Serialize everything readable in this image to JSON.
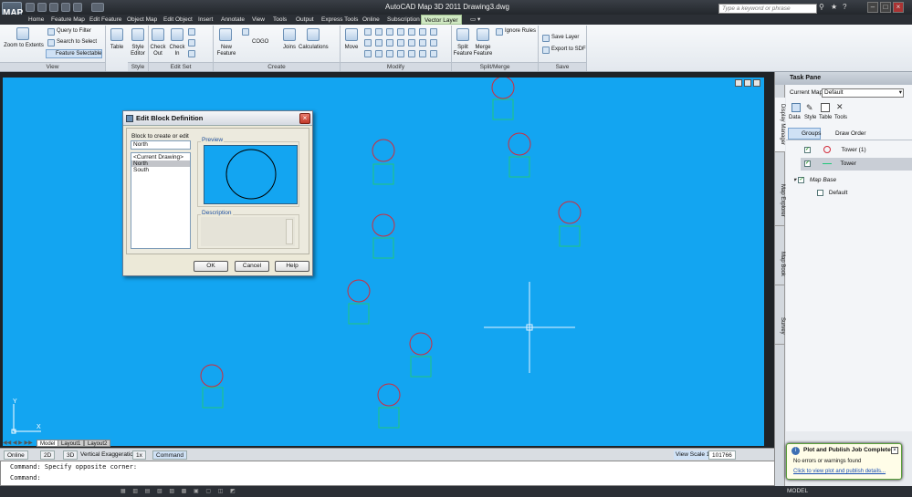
{
  "window": {
    "title": "AutoCAD Map 3D 2011    Drawing3.dwg",
    "app_button": "MAP",
    "search_placeholder": "Type a keyword or phrase"
  },
  "menu_tabs": [
    "Home",
    "Feature Map",
    "Edit Feature",
    "Object Map",
    "Edit Object",
    "Insert",
    "Annotate",
    "View",
    "Tools",
    "Output",
    "Express Tools",
    "Online",
    "Subscription",
    "Vector Layer"
  ],
  "active_tab": "Vector Layer",
  "ribbon": {
    "view": {
      "label": "View",
      "zoom": "Zoom to Extents",
      "query": "Query to Filter",
      "search": "Search to Select",
      "feature_selectable": "Feature Selectable"
    },
    "table": {
      "label": "Table"
    },
    "style": {
      "label": "Style",
      "style_editor": "Style Editor"
    },
    "editset": {
      "label": "Edit Set",
      "check_out": "Check Out",
      "check_in": "Check In"
    },
    "create": {
      "label": "Create",
      "new_feature": "New Feature",
      "cogo": "COGO",
      "joins": "Joins",
      "calculations": "Calculations"
    },
    "modify": {
      "label": "Modify",
      "move": "Move"
    },
    "splitmerge": {
      "label": "Split/Merge",
      "split": "Split Feature",
      "merge": "Merge Feature",
      "ignore": "Ignore Rules"
    },
    "save": {
      "label": "Save",
      "save_layer": "Save Layer",
      "export": "Export to SDF"
    }
  },
  "layout_tabs": [
    "Model",
    "Layout1",
    "Layout2"
  ],
  "status_bar": {
    "online": "Online",
    "view_2d": "2D",
    "view_3d": "3D",
    "vertical_exaggeration_label": "Vertical Exaggeration:",
    "vertical_exaggeration_value": "1x",
    "command": "Command",
    "view_scale_label": "View Scale",
    "view_scale_prefix": "1 :",
    "view_scale_value": "101766"
  },
  "command_lines": [
    "Command: Specify opposite corner:",
    "Command:"
  ],
  "app_status": {
    "model": "MODEL"
  },
  "task_pane": {
    "title": "Task Pane",
    "vertical_tabs": [
      "Display Manager",
      "Map Explorer",
      "Map Book",
      "Survey"
    ],
    "current_map_label": "Current Map:",
    "current_map_value": "Default",
    "toolbar": [
      "Data",
      "Style",
      "Table",
      "Tools"
    ],
    "view_buttons": {
      "groups": "Groups",
      "draw_order": "Draw Order"
    },
    "layers": [
      {
        "name": "Tower (1)",
        "checked": true,
        "symbol": "circle"
      },
      {
        "name": "Tower",
        "checked": true,
        "symbol": "line"
      }
    ],
    "group": {
      "name": "Map Base",
      "checked": true
    },
    "group_child": {
      "name": "Default",
      "checked": false
    }
  },
  "notification": {
    "title": "Plot and Publish Job Complete",
    "message": "No errors or warnings found",
    "link": "Click to view plot and publish details..."
  },
  "dialog": {
    "title": "Edit Block Definition",
    "block_label": "Block to create or edit",
    "block_value": "North",
    "list_items": [
      "<Current Drawing>",
      "North",
      "South"
    ],
    "selected_item": "North",
    "preview_label": "Preview",
    "description_label": "Description",
    "ok": "OK",
    "cancel": "Cancel",
    "help": "Help"
  },
  "colors": {
    "canvas": "#13a5f1",
    "circle": "#d22b3a",
    "square": "#21c77a",
    "crosshair": "#e6f2ff",
    "ribbon_active": "#cfe8c2"
  }
}
